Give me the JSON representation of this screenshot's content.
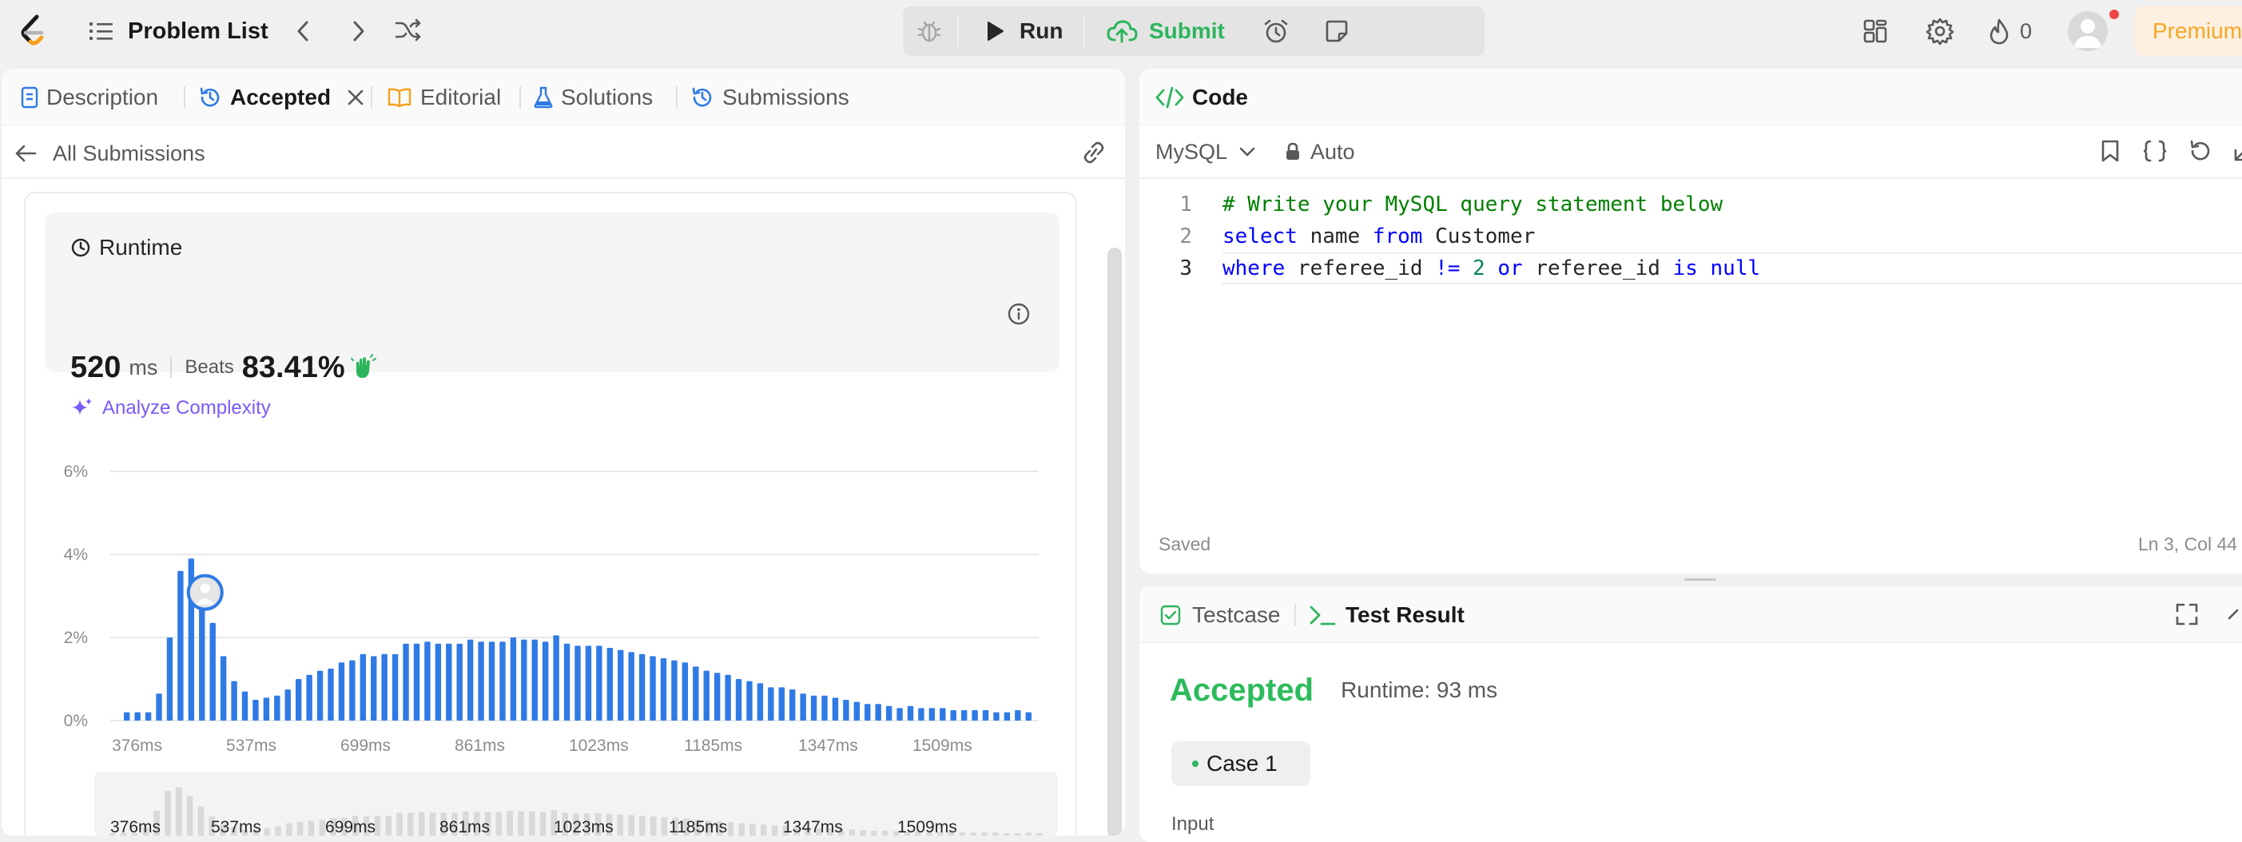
{
  "topbar": {
    "problem_list_label": "Problem List",
    "run_label": "Run",
    "submit_label": "Submit",
    "streak_count": "0",
    "premium_label": "Premium"
  },
  "left_tabs": [
    {
      "label": "Description",
      "icon": "doc-icon"
    },
    {
      "label": "Accepted",
      "icon": "history-icon"
    },
    {
      "label": "Editorial",
      "icon": "book-icon"
    },
    {
      "label": "Solutions",
      "icon": "flask-icon"
    },
    {
      "label": "Submissions",
      "icon": "history-icon"
    }
  ],
  "submissions": {
    "back_label": "All Submissions"
  },
  "runtime": {
    "title": "Runtime",
    "value": "520",
    "unit": "ms",
    "beats_label": "Beats",
    "beats_value": "83.41%",
    "analyze_label": "Analyze Complexity"
  },
  "chart_data": {
    "type": "bar",
    "ylabel": "",
    "xlabel": "",
    "y_ticks": [
      "6%",
      "4%",
      "2%",
      "0%"
    ],
    "ylim": [
      0,
      6
    ],
    "x_ticks": [
      "376ms",
      "537ms",
      "699ms",
      "861ms",
      "1023ms",
      "1185ms",
      "1347ms",
      "1509ms"
    ],
    "grid": true,
    "values": [
      0.2,
      0.2,
      0.2,
      0.65,
      2.0,
      3.6,
      3.9,
      3.2,
      2.35,
      1.55,
      0.95,
      0.7,
      0.5,
      0.55,
      0.6,
      0.75,
      1.0,
      1.1,
      1.2,
      1.25,
      1.4,
      1.45,
      1.6,
      1.55,
      1.6,
      1.6,
      1.85,
      1.85,
      1.9,
      1.85,
      1.85,
      1.85,
      1.95,
      1.9,
      1.9,
      1.9,
      2.0,
      1.95,
      1.95,
      1.9,
      2.05,
      1.85,
      1.8,
      1.8,
      1.8,
      1.75,
      1.7,
      1.65,
      1.6,
      1.55,
      1.5,
      1.45,
      1.4,
      1.3,
      1.2,
      1.15,
      1.1,
      1.0,
      0.95,
      0.9,
      0.8,
      0.8,
      0.75,
      0.65,
      0.6,
      0.6,
      0.55,
      0.5,
      0.45,
      0.4,
      0.4,
      0.35,
      0.3,
      0.35,
      0.3,
      0.3,
      0.3,
      0.25,
      0.25,
      0.25,
      0.25,
      0.2,
      0.2,
      0.25,
      0.2
    ],
    "highlight_index": 7,
    "bar_color": "#2f7ae5",
    "mini_bar_color": "#d9d9d9"
  },
  "code_panel": {
    "title": "Code",
    "language": "MySQL",
    "mode": "Auto",
    "status": "Saved",
    "cursor": "Ln 3, Col 44",
    "lines": [
      {
        "num": "1",
        "text": "# Write your MySQL query statement below"
      },
      {
        "num": "2",
        "text": "select name from Customer"
      },
      {
        "num": "3",
        "text": "where referee_id != 2 or referee_id is null"
      }
    ]
  },
  "test_panel": {
    "testcase_label": "Testcase",
    "result_label": "Test Result",
    "status": "Accepted",
    "runtime": "Runtime: 93 ms",
    "case_label": "Case 1",
    "input_label": "Input"
  },
  "colors": {
    "accent_blue": "#2f7ae5",
    "green": "#2db55d",
    "accepted_green": "#2cbb5d",
    "premium_bg": "#fdf0e0",
    "premium_text": "#f5a623",
    "purple": "#7a5af8"
  }
}
